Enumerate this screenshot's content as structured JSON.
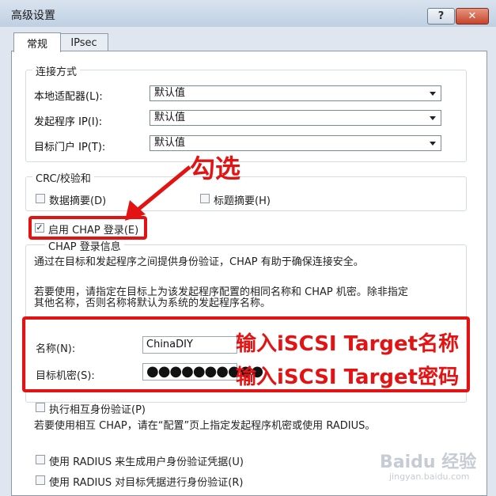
{
  "window": {
    "title": "高级设置",
    "help_label": "?",
    "close_label": "✕"
  },
  "tabs": [
    {
      "label": "常规"
    },
    {
      "label": "IPsec"
    }
  ],
  "connection": {
    "legend": "连接方式",
    "rows": [
      {
        "label": "本地适配器(L):",
        "value": "默认值"
      },
      {
        "label": "发起程序 IP(I):",
        "value": "默认值"
      },
      {
        "label": "目标门户 IP(T):",
        "value": "默认值"
      }
    ]
  },
  "crc": {
    "legend": "CRC/校验和",
    "data_digest": "数据摘要(D)",
    "header_digest": "标题摘要(H)"
  },
  "chap_enable": {
    "label": "启用 CHAP 登录(E)",
    "checked": true
  },
  "chap_info": {
    "legend": "CHAP 登录信息",
    "desc1": "通过在目标和发起程序之间提供身份验证，CHAP 有助于确保连接安全。",
    "desc2_line1": "若要使用，请指定在目标上为该发起程序配置的相同名称和 CHAP 机密。除非指定",
    "desc2_line2": "其他名称，否则名称将默认为系统的发起程序名称。",
    "name_label": "名称(N):",
    "name_value": "ChinaDIY",
    "secret_label": "目标机密(S):",
    "secret_value": "●●●●●●●●●●"
  },
  "mutual": {
    "label": "执行相互身份验证(P)",
    "desc": "若要使用相互 CHAP，请在“配置”页上指定发起程序机密或使用 RADIUS。"
  },
  "radius": [
    {
      "label": "使用 RADIUS 来生成用户身份验证凭据(U)"
    },
    {
      "label": "使用 RADIUS 对目标凭据进行身份验证(R)"
    }
  ],
  "annotations": {
    "check_note": "勾选",
    "name_note": "输入iSCSI Target名称",
    "secret_note": "输入iSCSI Target密码"
  },
  "watermark": {
    "brand": "Baidu 经验",
    "url": "jingyan.baidu.com"
  },
  "colors": {
    "annotation_red": "#e41313"
  }
}
